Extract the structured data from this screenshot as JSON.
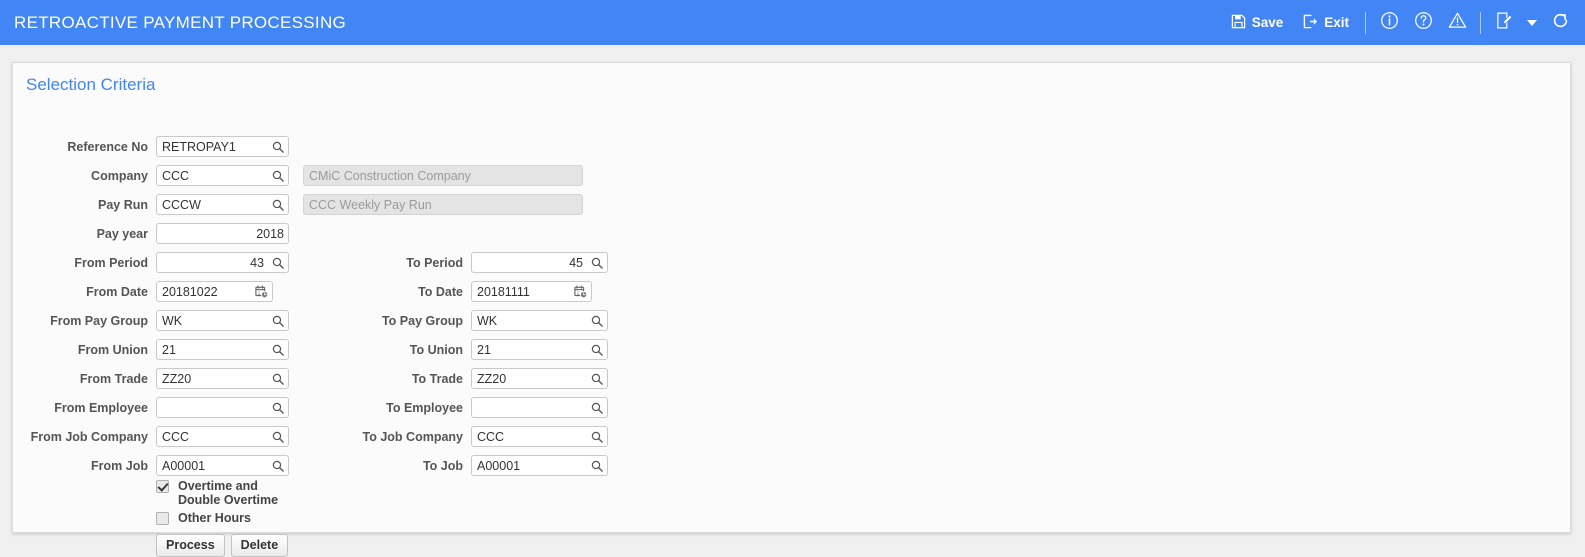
{
  "header": {
    "title": "RETROACTIVE PAYMENT PROCESSING",
    "accent_color": "#4285F4",
    "toolbar": [
      {
        "name": "save",
        "label": "Save",
        "icon": "save-icon"
      },
      {
        "name": "exit",
        "label": "Exit",
        "icon": "exit-icon"
      },
      {
        "name": "info",
        "label": "",
        "icon": "info-icon"
      },
      {
        "name": "help",
        "label": "",
        "icon": "help-icon"
      },
      {
        "name": "warning",
        "label": "",
        "icon": "warning-icon"
      },
      {
        "name": "notes",
        "label": "",
        "icon": "notes-edit-icon"
      },
      {
        "name": "more",
        "label": "",
        "icon": "chevron-down-icon"
      },
      {
        "name": "refresh",
        "label": "",
        "icon": "refresh-icon"
      }
    ]
  },
  "panel": {
    "title": "Selection Criteria",
    "title_color": "#4285F4"
  },
  "fields": {
    "reference_no": {
      "label": "Reference No",
      "value": "RETROPAY1",
      "icon": "search-icon"
    },
    "company": {
      "label": "Company",
      "value": "CCC",
      "icon": "search-icon"
    },
    "company_desc": {
      "label": "",
      "value": "CMiC Construction Company"
    },
    "pay_run": {
      "label": "Pay Run",
      "value": "CCCW",
      "icon": "search-icon"
    },
    "pay_run_desc": {
      "label": "",
      "value": "CCC Weekly Pay Run"
    },
    "pay_year": {
      "label": "Pay year",
      "value": "2018",
      "icon": ""
    },
    "from_period": {
      "label": "From Period",
      "value": "43",
      "icon": "search-icon"
    },
    "to_period": {
      "label": "To Period",
      "value": "45",
      "icon": "search-icon"
    },
    "from_date": {
      "label": "From Date",
      "value": "20181022",
      "icon": "calendar-clock-icon"
    },
    "to_date": {
      "label": "To Date",
      "value": "20181111",
      "icon": "calendar-clock-icon"
    },
    "from_pay_group": {
      "label": "From Pay Group",
      "value": "WK",
      "icon": "search-icon"
    },
    "to_pay_group": {
      "label": "To Pay Group",
      "value": "WK",
      "icon": "search-icon"
    },
    "from_union": {
      "label": "From Union",
      "value": "21",
      "icon": "search-icon"
    },
    "to_union": {
      "label": "To Union",
      "value": "21",
      "icon": "search-icon"
    },
    "from_trade": {
      "label": "From Trade",
      "value": "ZZ20",
      "icon": "search-icon"
    },
    "to_trade": {
      "label": "To Trade",
      "value": "ZZ20",
      "icon": "search-icon"
    },
    "from_employee": {
      "label": "From Employee",
      "value": "",
      "icon": "search-icon"
    },
    "to_employee": {
      "label": "To Employee",
      "value": "",
      "icon": "search-icon"
    },
    "from_job_company": {
      "label": "From Job Company",
      "value": "CCC",
      "icon": "search-icon"
    },
    "to_job_company": {
      "label": "To Job Company",
      "value": "CCC",
      "icon": "search-icon"
    },
    "from_job": {
      "label": "From Job",
      "value": "A00001",
      "icon": "search-icon"
    },
    "to_job": {
      "label": "To Job",
      "value": "A00001",
      "icon": "search-icon"
    }
  },
  "checkboxes": {
    "overtime": {
      "label": "Overtime and Double Overtime",
      "checked": true
    },
    "other_hours": {
      "label": "Other Hours",
      "checked": false
    }
  },
  "buttons": {
    "process": "Process",
    "delete": "Delete"
  }
}
